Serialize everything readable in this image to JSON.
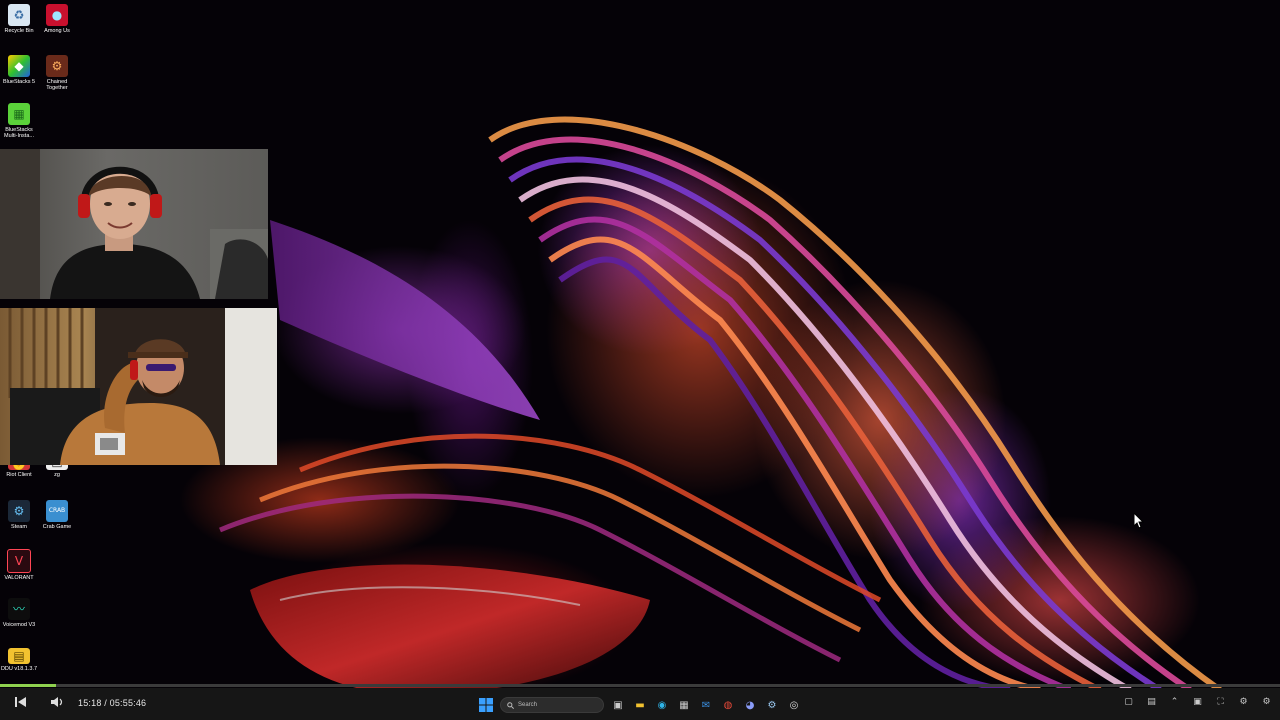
{
  "desktop_icons": [
    {
      "label": "Recycle Bin",
      "icon": "recycle-bin-icon"
    },
    {
      "label": "Among Us",
      "icon": "among-us-icon"
    },
    {
      "label": "BlueStacks 5",
      "icon": "bluestacks-icon"
    },
    {
      "label": "Chained Together",
      "icon": "chained-together-icon"
    },
    {
      "label": "BlueStacks Multi-Insta...",
      "icon": "bluestacks-multi-icon"
    },
    {
      "label": "Riot Client",
      "icon": "riot-client-icon"
    },
    {
      "label": "zg",
      "icon": "zg-icon"
    },
    {
      "label": "Steam",
      "icon": "steam-icon"
    },
    {
      "label": "Crab Game",
      "icon": "crab-game-icon"
    },
    {
      "label": "VALORANT",
      "icon": "valorant-icon"
    },
    {
      "label": "Voicemod V3",
      "icon": "voicemod-icon"
    },
    {
      "label": "DDU v18.1.3.7",
      "icon": "ddu-icon"
    }
  ],
  "player": {
    "time_readout": "15:18 / 05:55:46",
    "progress": 0.044,
    "progress_color": "#8fd14f"
  },
  "taskbar": {
    "search_placeholder": "Search",
    "accent": "#0078d4"
  },
  "colors": {
    "taskbar_bg": "#161616",
    "wallpaper_bg": "#050207"
  }
}
